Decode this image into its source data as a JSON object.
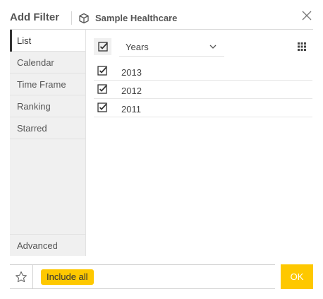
{
  "header": {
    "title": "Add Filter",
    "source_name": "Sample Healthcare"
  },
  "sidebar": {
    "items": [
      {
        "label": "List",
        "active": true
      },
      {
        "label": "Calendar",
        "active": false
      },
      {
        "label": "Time Frame",
        "active": false
      },
      {
        "label": "Ranking",
        "active": false
      },
      {
        "label": "Starred",
        "active": false
      }
    ],
    "advanced_label": "Advanced"
  },
  "main": {
    "dimension_select": {
      "selected": "Years"
    },
    "rows": [
      {
        "label": "2013",
        "checked": true
      },
      {
        "label": "2012",
        "checked": true
      },
      {
        "label": "2011",
        "checked": true
      }
    ]
  },
  "footer": {
    "tag_label": "Include all",
    "ok_label": "OK"
  },
  "colors": {
    "accent": "#fec800",
    "sidebar_bg": "#f0f0f0",
    "text": "#333333"
  },
  "icons": [
    "cube-icon",
    "close-icon",
    "check-icon",
    "chevron-down-icon",
    "grid-dots-icon",
    "star-icon"
  ]
}
